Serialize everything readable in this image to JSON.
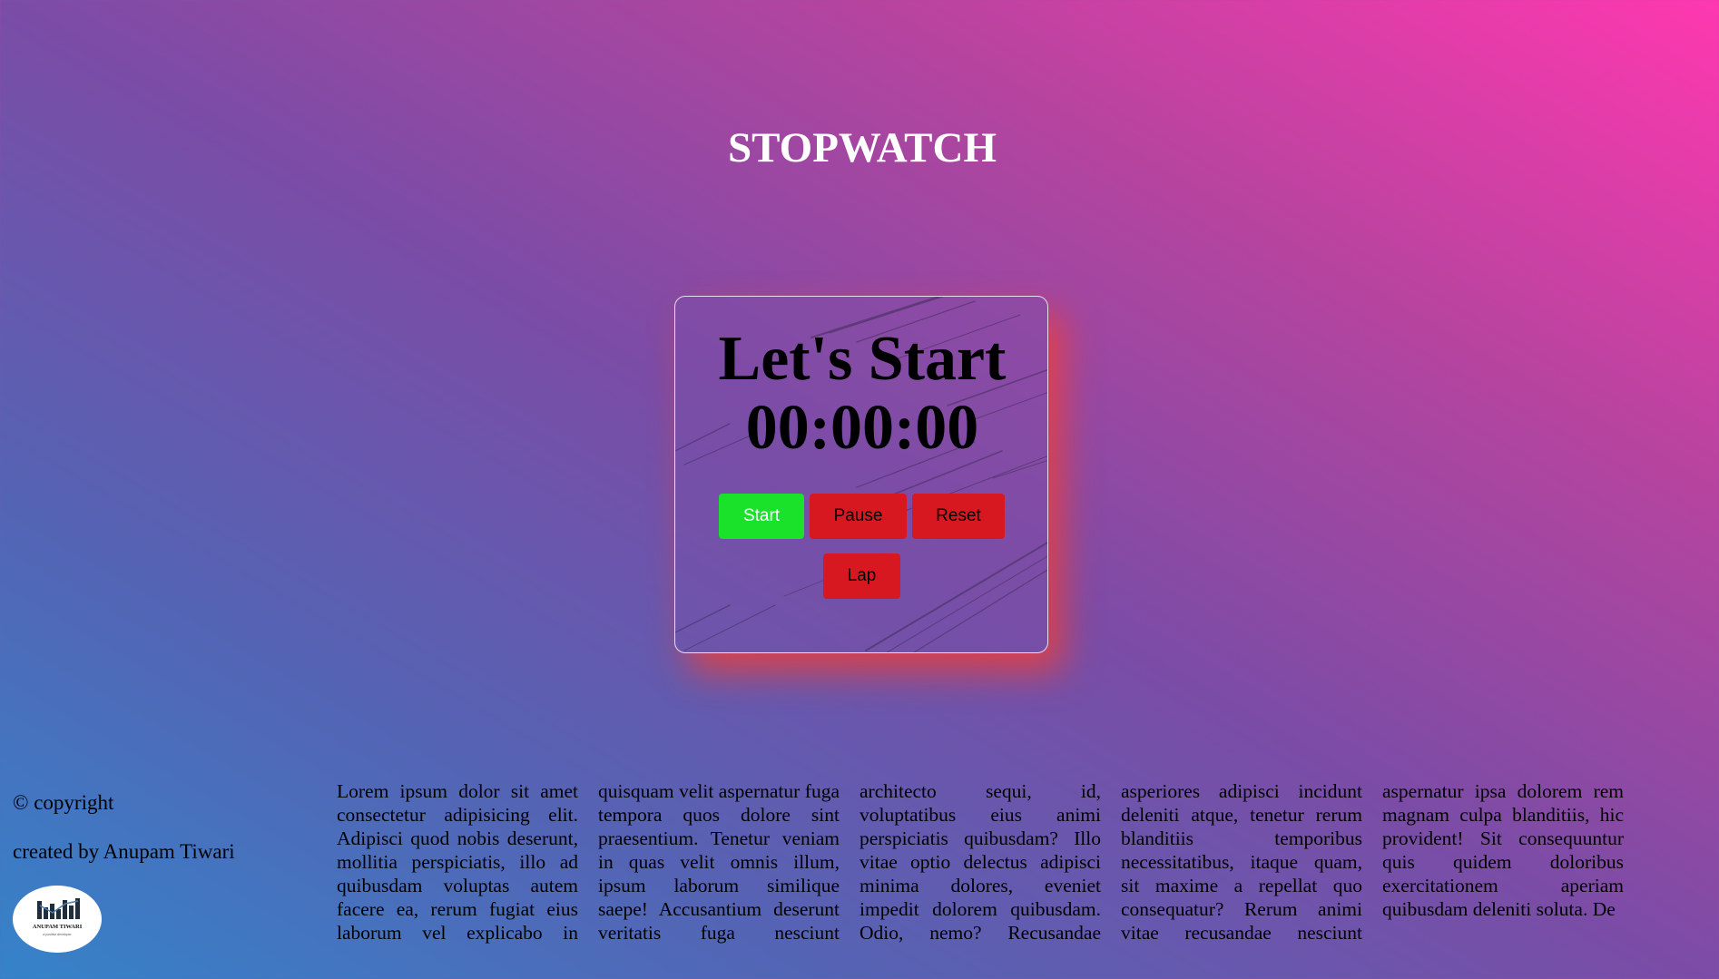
{
  "page": {
    "title": "STOPWATCH"
  },
  "stopwatch": {
    "heading": "Let's Start",
    "time": "00:00:00",
    "buttons": {
      "start": "Start",
      "pause": "Pause",
      "reset": "Reset",
      "lap": "Lap"
    }
  },
  "footer": {
    "copyright": "© copyright",
    "created_by": "created by Anupam Tiwari",
    "logo": {
      "icon": "bar-chart-logo-icon",
      "name": "ANUPAM TIWARI",
      "tagline": "a positive developer"
    },
    "paragraphs": [
      "Lorem ipsum dolor sit amet consectetur adipisicing elit. Adipisci quod nobis deserunt, mollitia perspiciatis, illo ad quibusdam voluptas autem facere ea, rerum fugiat eius laborum vel explicabo in",
      "quisquam velit aspernatur fuga tempora quos dolore sint praesentium. Tenetur veniam in quas velit omnis illum, ipsum laborum similique saepe! Accusantium deserunt veritatis fuga nesciunt",
      "architecto sequi, id, voluptatibus eius animi perspiciatis quibusdam? Illo vitae optio delectus adipisci minima dolores, eveniet impedit dolorem quibusdam. Odio, nemo? Recusandae",
      "asperiores adipisci incidunt deleniti atque, tenetur rerum blanditiis temporibus necessitatibus, itaque quam, sit maxime a repellat quo consequatur? Rerum animi vitae recusandae nesciunt",
      "aspernatur ipsa dolorem rem magnam culpa blanditiis, hic provident! Sit consequuntur quis quidem doloribus exercitationem aperiam quibusdam deleniti soluta. De"
    ]
  },
  "colors": {
    "start_button": "#1ae22a",
    "stop_buttons": "#d81820",
    "card_glow": "#ff3c28",
    "gradient_start": "#3583c9",
    "gradient_end": "#ff38b0"
  }
}
